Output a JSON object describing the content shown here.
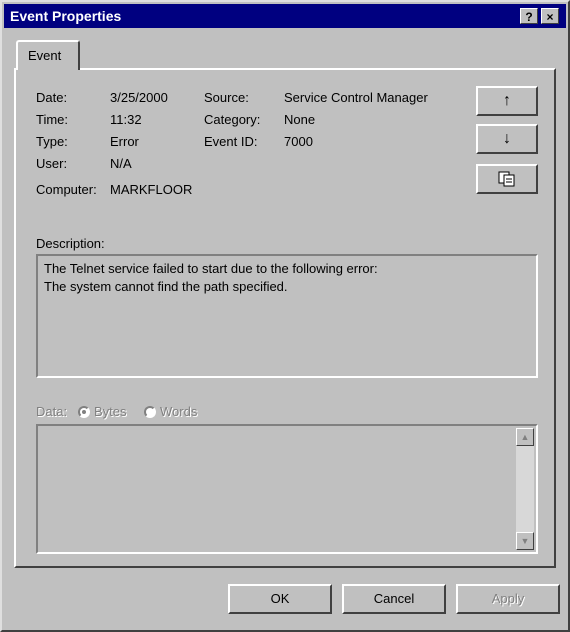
{
  "window": {
    "title": "Event Properties",
    "help_label": "?",
    "close_label": "×"
  },
  "tabs": [
    {
      "label": "Event"
    }
  ],
  "fields": {
    "date": {
      "label": "Date:",
      "value": "3/25/2000"
    },
    "time": {
      "label": "Time:",
      "value": "11:32"
    },
    "type": {
      "label": "Type:",
      "value": "Error"
    },
    "user": {
      "label": "User:",
      "value": "N/A"
    },
    "computer": {
      "label": "Computer:",
      "value": "MARKFLOOR"
    },
    "source": {
      "label": "Source:",
      "value": "Service Control Manager"
    },
    "category": {
      "label": "Category:",
      "value": "None"
    },
    "event_id": {
      "label": "Event ID:",
      "value": "7000"
    }
  },
  "nav": {
    "up_icon": "↑",
    "down_icon": "↓",
    "copy_icon": "copy-icon"
  },
  "description": {
    "label": "Description:",
    "lines": [
      "The Telnet service failed to start due to the following error:",
      "The system cannot find the path specified."
    ]
  },
  "data_section": {
    "label": "Data:",
    "bytes_label": "Bytes",
    "words_label": "Words",
    "selected": "Bytes"
  },
  "buttons": {
    "ok": "OK",
    "cancel": "Cancel",
    "apply": "Apply"
  }
}
